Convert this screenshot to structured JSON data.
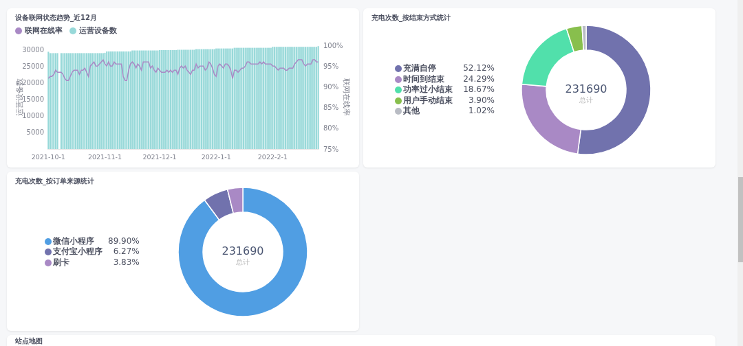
{
  "panels": [
    {
      "kind": "combo",
      "title": "设备联网状态趋势_近12月",
      "layers": [
        {
          "chart_data": {
            "type": "line",
            "ylabel": "联网在线率",
            "ylim": [
              75,
              100
            ],
            "yticks": [
              {
                "value": 75,
                "label": "75%"
              },
              {
                "value": 80,
                "label": "80%"
              },
              {
                "value": 85,
                "label": "85%"
              },
              {
                "value": 90,
                "label": "90%"
              },
              {
                "value": 95,
                "label": "95%"
              },
              {
                "value": 100,
                "label": "100%"
              }
            ],
            "series": [
              {
                "name": "联网在线率",
                "color": "#a989c5",
                "values": [
                  92,
                  92.5,
                  92.5,
                  93,
                  94,
                  93.5,
                  93.5,
                  93.5,
                  93,
                  92,
                  91.5,
                  91.5,
                  92.5,
                  93.5,
                  94,
                  94,
                  94,
                  93,
                  94,
                  94,
                  94.5,
                  93.5,
                  92.5,
                  95,
                  95.5,
                  96,
                  95,
                  95,
                  95.5,
                  96,
                  96.5,
                  95.5,
                  95,
                  96,
                  95,
                  95,
                  96,
                  95.5,
                  95.5,
                  95.5,
                  95.5,
                  92.5,
                  91.5,
                  91.5,
                  94,
                  95.5,
                  96,
                  95.5,
                  94.5,
                  95.5,
                  95,
                  94,
                  96,
                  96,
                  96,
                  96,
                  94.5,
                  95,
                  94,
                  93.5,
                  94.5,
                  94,
                  93.5,
                  93.5,
                  93.5,
                  94,
                  93.5,
                  94,
                  93.5,
                  94,
                  94,
                  93,
                  94.5,
                  95,
                  94.5,
                  95,
                  94,
                  93.5,
                  93,
                  94,
                  94,
                  95.5,
                  94.5,
                  95,
                  95,
                  95,
                  94,
                  94.5,
                  96,
                  95.5,
                  94.5,
                  93,
                  92.5,
                  95,
                  95.5,
                  95,
                  94.5,
                  95.5,
                  95.5,
                  95,
                  94,
                  92,
                  94,
                  94,
                  93.5,
                  94,
                  94.5,
                  94.5,
                  95,
                  96,
                  96,
                  95.5,
                  95.5,
                  95.5,
                  95.5,
                  95.5,
                  96,
                  95.5,
                  96,
                  95.5,
                  95.5,
                  95.5,
                  95.5,
                  95,
                  95,
                  94.5,
                  94,
                  94.5,
                  94.5,
                  94.5,
                  94,
                  94,
                  94.5,
                  94.5,
                  94.5,
                  95.5,
                  96,
                  96.5,
                  96.5,
                  96.5,
                  95.5,
                  95,
                  95.5,
                  95.5,
                  95.5,
                  96.5,
                  96.5,
                  96,
                  96
                ]
              }
            ]
          }
        },
        {
          "chart_data": {
            "type": "bar",
            "ylabel": "运营设备数",
            "ylim": [
              0,
              31250
            ],
            "categories": [
              "2021-10-1",
              null,
              null,
              null,
              null,
              null,
              null,
              null,
              null,
              null,
              null,
              null,
              null,
              null,
              null,
              null,
              null,
              null,
              null,
              null,
              null,
              null,
              null,
              null,
              null,
              null,
              null,
              null,
              null,
              null,
              null,
              "2021-11-1",
              null,
              null,
              null,
              null,
              null,
              null,
              null,
              null,
              null,
              null,
              null,
              null,
              null,
              null,
              null,
              null,
              null,
              null,
              null,
              null,
              null,
              null,
              null,
              null,
              null,
              null,
              null,
              null,
              null,
              "2021-12-1",
              null,
              null,
              null,
              null,
              null,
              null,
              null,
              null,
              null,
              null,
              null,
              null,
              null,
              null,
              null,
              null,
              null,
              null,
              null,
              null,
              null,
              null,
              null,
              null,
              null,
              null,
              null,
              null,
              null,
              null,
              "2022-1-1",
              null,
              null,
              null,
              null,
              null,
              null,
              null,
              null,
              null,
              null,
              null,
              null,
              null,
              null,
              null,
              null,
              null,
              null,
              null,
              null,
              null,
              null,
              null,
              null,
              null,
              null,
              null,
              null,
              null,
              null,
              "2022-2-1",
              null,
              null,
              null,
              null,
              null,
              null,
              null,
              null,
              null,
              null,
              null,
              null,
              null,
              null,
              null,
              null,
              null,
              null,
              null,
              null,
              null,
              null,
              null,
              null,
              null
            ],
            "yticks": [
              5000,
              10000,
              15000,
              20000,
              25000,
              30000
            ],
            "series": [
              {
                "name": "运营设备数",
                "color": "#98d9d9",
                "values": [
                  29300,
                  28900,
                  28900,
                  28900,
                  28900,
                  28900,
                  null,
                  28900,
                  28900,
                  28900,
                  28900,
                  28900,
                  28900,
                  28900,
                  28900,
                  28900,
                  28900,
                  28900,
                  28900,
                  28900,
                  28900,
                  28900,
                  28900,
                  28900,
                  28900,
                  28900,
                  28900,
                  28900,
                  28900,
                  28900,
                  28900,
                  29000,
                  29400,
                  29400,
                  29400,
                  29400,
                  29400,
                  29400,
                  29400,
                  29400,
                  29400,
                  29400,
                  29400,
                  29400,
                  29400,
                  29400,
                  29700,
                  29700,
                  29700,
                  29700,
                  29700,
                  29700,
                  29700,
                  29700,
                  29700,
                  29700,
                  29700,
                  29700,
                  29700,
                  29700,
                  29700,
                  29800,
                  29800,
                  29800,
                  29800,
                  29800,
                  29800,
                  29800,
                  29800,
                  29800,
                  29800,
                  29900,
                  29900,
                  29900,
                  29900,
                  29900,
                  29900,
                  29900,
                  29900,
                  29900,
                  29900,
                  30100,
                  30100,
                  30100,
                  30100,
                  30100,
                  30100,
                  30100,
                  30100,
                  30100,
                  30100,
                  30100,
                  30300,
                  30300,
                  30300,
                  30300,
                  30300,
                  30300,
                  30300,
                  30300,
                  30300,
                  30300,
                  30500,
                  30500,
                  30500,
                  30500,
                  30500,
                  30500,
                  30500,
                  30500,
                  30500,
                  30500,
                  30500,
                  30500,
                  30500,
                  30500,
                  30500,
                  30500,
                  30500,
                  30500,
                  30500,
                  30500,
                  30500,
                  30800,
                  30800,
                  30800,
                  30800,
                  30800,
                  30800,
                  30800,
                  30800,
                  30800,
                  30800,
                  30800,
                  30800,
                  30800,
                  30800,
                  30800,
                  30800,
                  30800,
                  30800,
                  30800,
                  30800,
                  30800,
                  30800,
                  30800,
                  30800,
                  30800,
                  31000
                ]
              }
            ]
          }
        }
      ]
    },
    {
      "kind": "donut",
      "center_value": "231690",
      "center_label": "总计",
      "chart_data": {
        "type": "donut",
        "title": "充电次数_按结束方式统计",
        "categories": [
          "充满自停",
          "时间到结束",
          "功率过小结束",
          "用户手动结束",
          "其他"
        ],
        "values": [
          52.12,
          24.29,
          18.67,
          3.9,
          1.02
        ],
        "value_labels": [
          "52.12%",
          "24.29%",
          "18.67%",
          "3.90%",
          "1.02%"
        ],
        "colors": [
          "#7172ad",
          "#a989c5",
          "#51e0ab",
          "#88bf4d",
          "#b9bcc4"
        ]
      }
    },
    {
      "kind": "donut",
      "center_value": "231690",
      "center_label": "总计",
      "chart_data": {
        "type": "donut",
        "title": "充电次数_按订单来源统计",
        "categories": [
          "微信小程序",
          "支付宝小程序",
          "刷卡"
        ],
        "values": [
          89.9,
          6.27,
          3.83
        ],
        "value_labels": [
          "89.90%",
          "6.27%",
          "3.83%"
        ],
        "colors": [
          "#509ee3",
          "#7172ad",
          "#a989c5"
        ]
      }
    },
    {
      "kind": "map",
      "title": "站点地图"
    }
  ]
}
